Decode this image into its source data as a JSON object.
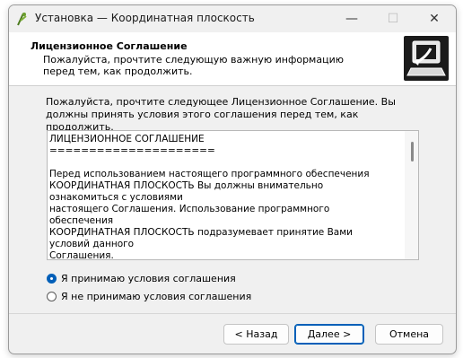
{
  "window": {
    "title": "Установка — Координатная плоскость",
    "minimize_glyph": "—",
    "maximize_glyph": "☐",
    "close_glyph": "✕"
  },
  "header": {
    "title": "Лицензионное Соглашение",
    "subtitle": "Пожалуйста, прочтите следующую важную информацию перед тем, как продолжить.",
    "image_icon": "computer-install-icon"
  },
  "intro": "Пожалуйста, прочтите следующее Лицензионное Соглашение. Вы должны принять условия этого соглашения перед тем, как продолжить.",
  "license_text": "ЛИЦЕНЗИОННОЕ СОГЛАШЕНИЕ\n=====================\n\nПеред использованием настоящего программного обеспечения\nКООРДИНАТНАЯ ПЛОСКОСТЬ Вы должны внимательно ознакомиться с условиями\nнастоящего Соглашения. Использование программного обеспечения\nКООРДИНАТНАЯ ПЛОСКОСТЬ подразумевает принятие Вами условий данного\nСоглашения.",
  "options": {
    "accept": "Я принимаю условия соглашения",
    "decline": "Я не принимаю условия соглашения",
    "selected": "accept"
  },
  "buttons": {
    "back": "< Назад",
    "next": "Далее >",
    "cancel": "Отмена"
  },
  "colors": {
    "accent": "#005fb8"
  }
}
